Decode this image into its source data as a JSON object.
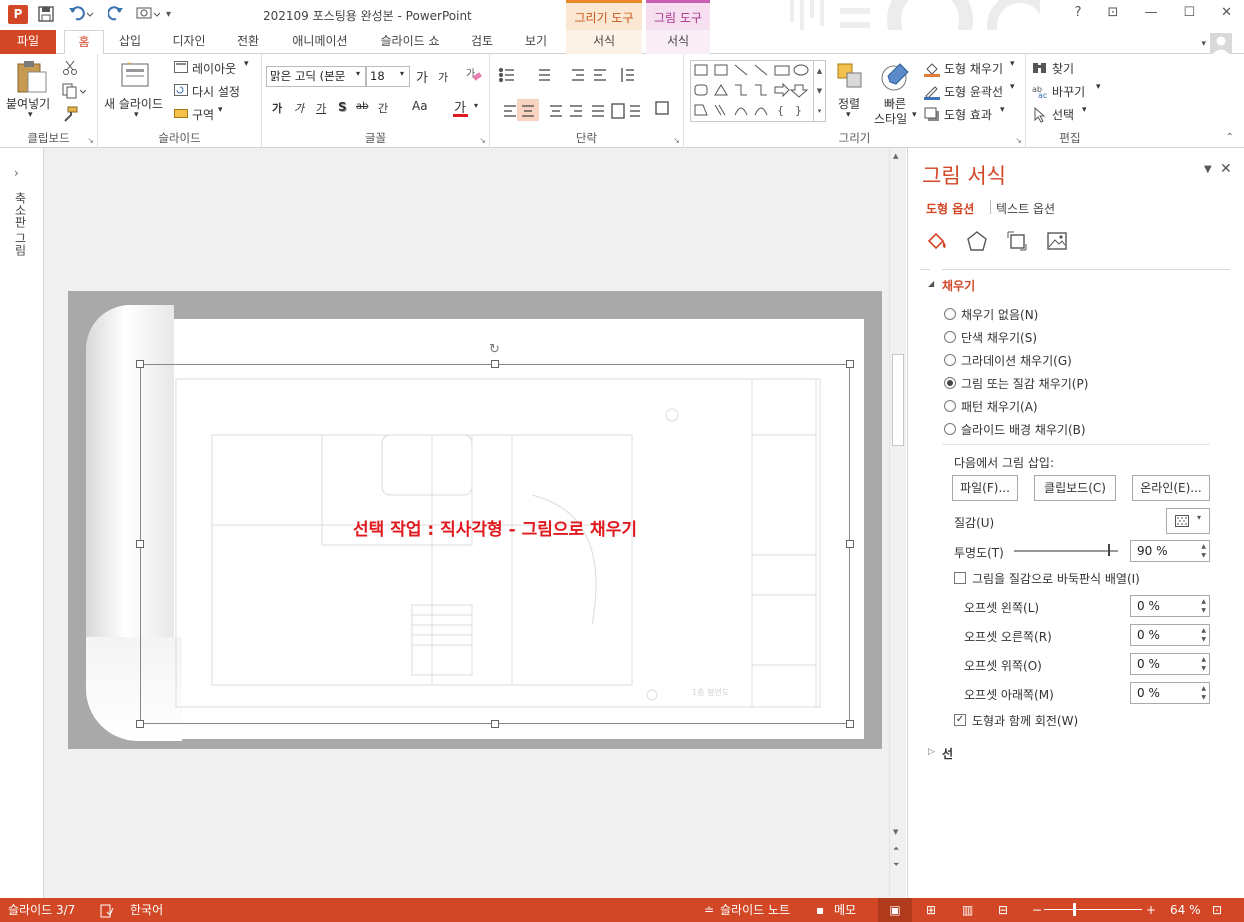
{
  "titlebar": {
    "app_logo": "P",
    "document_title": "202109 포스팅용 완성본 - PowerPoint",
    "context_drawing": "그리기 도구",
    "context_picture": "그림 도구",
    "help": "?",
    "icons": [
      "powerpoint-logo",
      "save-icon",
      "undo-icon",
      "redo-icon",
      "present-icon",
      "customize-icon"
    ]
  },
  "tabs": {
    "file": "파일",
    "home": "홈",
    "insert": "삽입",
    "design": "디자인",
    "transitions": "전환",
    "animations": "애니메이션",
    "slideshow": "슬라이드 쇼",
    "review": "검토",
    "view": "보기",
    "format_drawing": "서식",
    "format_picture": "서식"
  },
  "ribbon": {
    "clipboard": {
      "paste": "붙여넣기",
      "label": "클립보드"
    },
    "slides": {
      "new_slide": "새 슬라이드",
      "layout": "레이아웃",
      "reset": "다시 설정",
      "section": "구역",
      "label": "슬라이드"
    },
    "font": {
      "font_name": "맑은 고딕 (본문",
      "font_size": "18",
      "grow": "가",
      "shrink": "가",
      "bold": "가",
      "italic": "가",
      "underline": "가",
      "shadow": "S",
      "strike": "ab",
      "spacing": "간",
      "case": "Aa",
      "color": "가",
      "label": "글꼴"
    },
    "paragraph": {
      "label": "단락"
    },
    "drawing": {
      "arrange": "정렬",
      "quick_styles_1": "빠른",
      "quick_styles_2": "스타일",
      "shape_fill": "도형 채우기",
      "shape_outline": "도형 윤곽선",
      "shape_effects": "도형 효과",
      "label": "그리기"
    },
    "editing": {
      "find": "찾기",
      "replace": "바꾸기",
      "select": "선택",
      "label": "편집"
    }
  },
  "left_strip": {
    "label": "축소판 그림",
    "toggle": "›"
  },
  "slide": {
    "caption": "선택 작업 : 직사각형 - 그림으로 채우기",
    "caption_color": "#e0191f",
    "drawing_note": "1층 평면도"
  },
  "pane": {
    "title": "그림 서식",
    "tab_shape": "도형 옵션",
    "tab_text": "텍스트 옵션",
    "fill_section": "채우기",
    "fill_options": [
      {
        "label": "채우기 없음(N)",
        "selected": false
      },
      {
        "label": "단색 채우기(S)",
        "selected": false
      },
      {
        "label": "그라데이션 채우기(G)",
        "selected": false
      },
      {
        "label": "그림 또는 질감 채우기(P)",
        "selected": true
      },
      {
        "label": "패턴 채우기(A)",
        "selected": false
      },
      {
        "label": "슬라이드 배경 채우기(B)",
        "selected": false
      }
    ],
    "insert_from": "다음에서 그림 삽입:",
    "btn_file": "파일(F)...",
    "btn_clipboard": "클립보드(C)",
    "btn_online": "온라인(E)...",
    "texture_label": "질감(U)",
    "transparency_label": "투명도(T)",
    "transparency_value": "90 %",
    "transparency_fraction": 0.9,
    "tile_label": "그림을 질감으로 바둑판식 배열(I)",
    "offset_left_label": "오프셋 왼쪽(L)",
    "offset_left": "0 %",
    "offset_right_label": "오프셋 오른쪽(R)",
    "offset_right": "0 %",
    "offset_top_label": "오프셋 위쪽(O)",
    "offset_top": "0 %",
    "offset_bottom_label": "오프셋 아래쪽(M)",
    "offset_bottom": "0 %",
    "rotate_label": "도형과 함께 회전(W)",
    "line_section": "선"
  },
  "status": {
    "slide": "슬라이드 3/7",
    "language": "한국어",
    "notes": "슬라이드 노트",
    "comments": "메모",
    "zoom": "64 %"
  },
  "colors": {
    "accent": "#d24726",
    "ribbon_border": "#d4d4d4",
    "canvas": "#f0f0f0"
  }
}
